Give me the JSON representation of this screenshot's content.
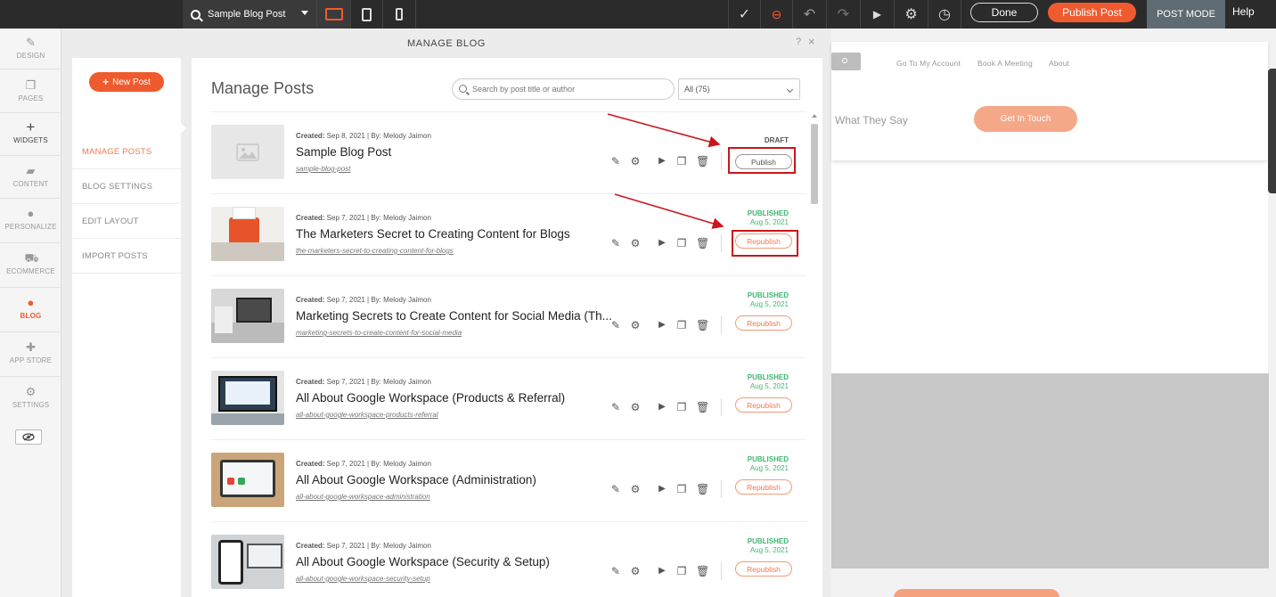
{
  "topbar": {
    "page_name": "Sample Blog Post",
    "done_label": "Done",
    "publish_label": "Publish Post",
    "mode_label": "POST MODE",
    "help_label": "Help"
  },
  "sidebar": {
    "items": [
      {
        "label": "DESIGN",
        "icon": "brush-icon"
      },
      {
        "label": "PAGES",
        "icon": "pages-icon"
      },
      {
        "label": "WIDGETS",
        "icon": "plus-icon"
      },
      {
        "label": "CONTENT",
        "icon": "folder-icon"
      },
      {
        "label": "PERSONALIZE",
        "icon": "person-icon"
      },
      {
        "label": "ECOMMERCE",
        "icon": "cart-icon"
      },
      {
        "label": "BLOG",
        "icon": "chat-icon"
      },
      {
        "label": "APP STORE",
        "icon": "puzzle-icon"
      },
      {
        "label": "SETTINGS",
        "icon": "gear-icon"
      }
    ]
  },
  "panel": {
    "title": "MANAGE BLOG",
    "help": "?",
    "close": "×"
  },
  "subnav": {
    "new_post": "New Post",
    "items": [
      "MANAGE POSTS",
      "BLOG SETTINGS",
      "EDIT LAYOUT",
      "IMPORT POSTS"
    ]
  },
  "main": {
    "title": "Manage Posts",
    "search_placeholder": "Search by post title or author",
    "filter": "All (75)"
  },
  "posts": [
    {
      "meta_label": "Created:",
      "meta": " Sep 8, 2021 | By: Melody Jaimon",
      "title": "Sample Blog Post",
      "slug": "sample-blog-post",
      "status": "DRAFT",
      "date": "",
      "action": "Publish"
    },
    {
      "meta_label": "Created:",
      "meta": " Sep 7, 2021 | By: Melody Jaimon",
      "title": "The Marketers Secret to Creating Content for Blogs",
      "slug": "the-marketers-secret-to-creating-content-for-blogs",
      "status": "PUBLISHED",
      "date": "Aug 5, 2021",
      "action": "Republish"
    },
    {
      "meta_label": "Created:",
      "meta": " Sep 7, 2021 | By: Melody Jaimon",
      "title": "Marketing Secrets to Create Content for Social Media (Th...",
      "slug": "marketing-secrets-to-create-content-for-social-media",
      "status": "PUBLISHED",
      "date": "Aug 5, 2021",
      "action": "Republish"
    },
    {
      "meta_label": "Created:",
      "meta": " Sep 7, 2021 | By: Melody Jaimon",
      "title": "All About Google Workspace (Products & Referral)",
      "slug": "all-about-google-workspace-products-referral",
      "status": "PUBLISHED",
      "date": "Aug 5, 2021",
      "action": "Republish"
    },
    {
      "meta_label": "Created:",
      "meta": " Sep 7, 2021 | By: Melody Jaimon",
      "title": "All About Google Workspace (Administration)",
      "slug": "all-about-google-workspace-administration",
      "status": "PUBLISHED",
      "date": "Aug 5, 2021",
      "action": "Republish"
    },
    {
      "meta_label": "Created:",
      "meta": " Sep 7, 2021 | By: Melody Jaimon",
      "title": "All About Google Workspace (Security & Setup)",
      "slug": "all-about-google-workspace-security-setup",
      "status": "PUBLISHED",
      "date": "Aug 5, 2021",
      "action": "Republish"
    }
  ],
  "preview": {
    "nav_links": [
      "Go To My Account",
      "Book A Meeting",
      "About"
    ],
    "what_they_say": "What They Say",
    "cta": "Get In Touch"
  },
  "colors": {
    "accent": "#ef5b2f",
    "published": "#3fb870",
    "annotation": "#c8161c"
  }
}
